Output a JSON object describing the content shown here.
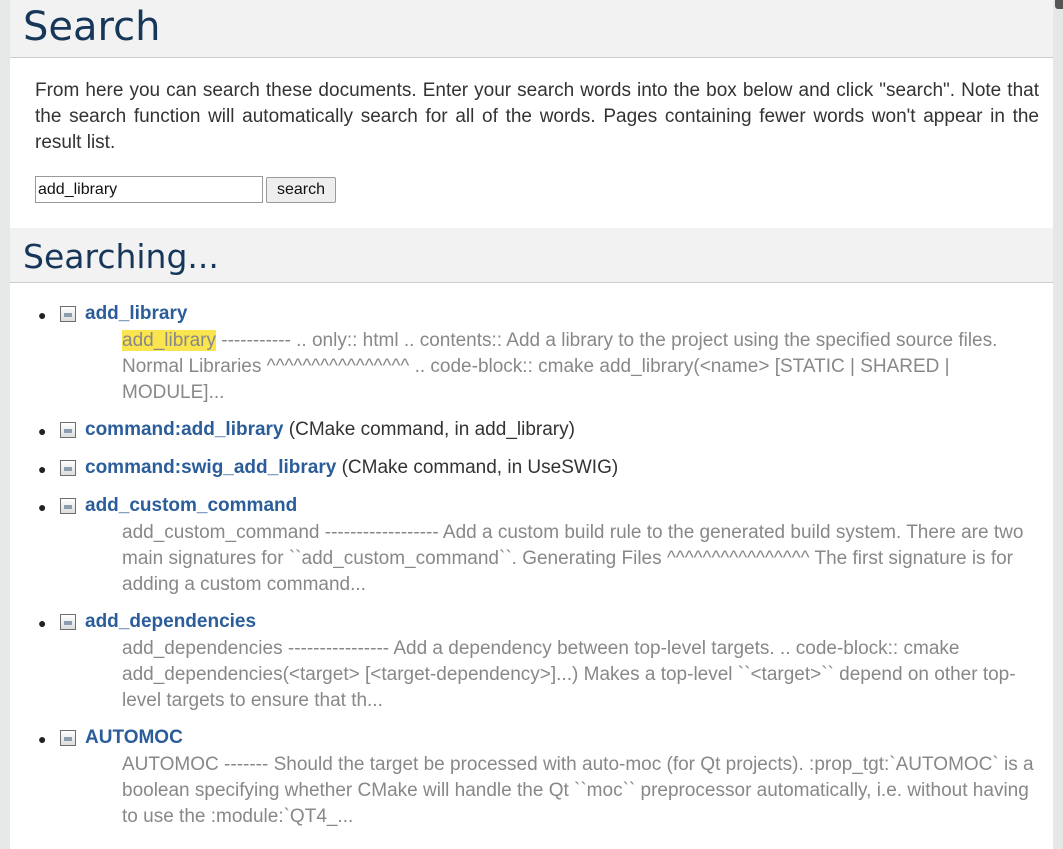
{
  "page": {
    "title": "Search",
    "intro": "From here you can search these documents. Enter your search words into the box below and click \"search\". Note that the search function will automatically search for all of the words. Pages containing fewer words won't appear in the result list."
  },
  "search": {
    "value": "add_library",
    "button_label": "search"
  },
  "results_heading": "Searching...",
  "results": [
    {
      "title": "add_library",
      "suffix": "",
      "context_highlight": "add_library",
      "context": " ----------- .. only:: html .. contents:: Add a library to the project using the specified source files. Normal Libraries ^^^^^^^^^^^^^^^^ .. code-block:: cmake add_library(<name> [STATIC | SHARED | MODULE]..."
    },
    {
      "title": "command:add_library",
      "suffix": " (CMake command, in add_library)"
    },
    {
      "title": "command:swig_add_library",
      "suffix": " (CMake command, in UseSWIG)"
    },
    {
      "title": "add_custom_command",
      "suffix": "",
      "context": "add_custom_command ------------------ Add a custom build rule to the generated build system. There are two main signatures for ``add_custom_command``. Generating Files ^^^^^^^^^^^^^^^^ The first signature is for adding a custom command..."
    },
    {
      "title": "add_dependencies",
      "suffix": "",
      "context": "add_dependencies ---------------- Add a dependency between top-level targets. .. code-block:: cmake add_dependencies(<target> [<target-dependency>]...) Makes a top-level ``<target>`` depend on other top-level targets to ensure that th..."
    },
    {
      "title": "AUTOMOC",
      "suffix": "",
      "context": "AUTOMOC ------- Should the target be processed with auto-moc (for Qt projects). :prop_tgt:`AUTOMOC` is a boolean specifying whether CMake will handle the Qt ``moc`` preprocessor automatically, i.e. without having to use the :module:`QT4_..."
    }
  ]
}
